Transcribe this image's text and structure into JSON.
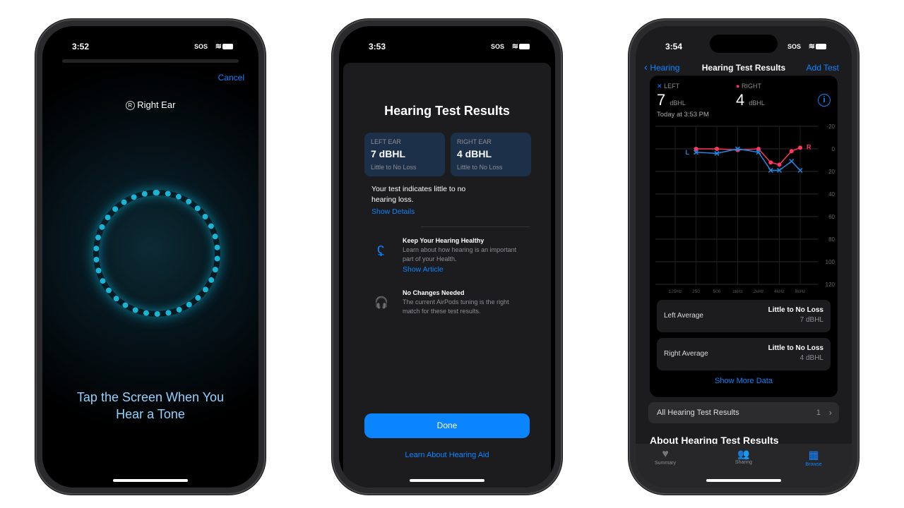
{
  "phone1": {
    "time": "3:52",
    "sos": "SOS",
    "cancel": "Cancel",
    "ear_label": "Right Ear",
    "ear_badge": "R",
    "instruction": "Tap the Screen When You Hear a Tone"
  },
  "phone2": {
    "time": "3:53",
    "sos": "SOS",
    "title": "Hearing Test Results",
    "left": {
      "label": "LEFT EAR",
      "value": "7 dBHL",
      "desc": "Little to No Loss"
    },
    "right": {
      "label": "RIGHT EAR",
      "value": "4 dBHL",
      "desc": "Little to No Loss"
    },
    "summary": "Your test indicates little to no hearing loss.",
    "show_details": "Show Details",
    "tips": [
      {
        "icon": "ear-check-icon",
        "title": "Keep Your Hearing Healthy",
        "body": "Learn about how hearing is an important part of your Health.",
        "link": "Show Article"
      },
      {
        "icon": "airpods-icon",
        "title": "No Changes Needed",
        "body": "The current AirPods tuning is the right match for these test results."
      }
    ],
    "done": "Done",
    "learn": "Learn About Hearing Aid"
  },
  "phone3": {
    "time": "3:54",
    "sos": "SOS",
    "back": "Hearing",
    "title": "Hearing Test Results",
    "add": "Add Test",
    "left_legend": "LEFT",
    "right_legend": "RIGHT",
    "left_value": "7",
    "right_value": "4",
    "unit": "dBHL",
    "date": "Today at 3:53 PM",
    "averages": [
      {
        "label": "Left Average",
        "status": "Little to No Loss",
        "value": "7 dBHL"
      },
      {
        "label": "Right Average",
        "status": "Little to No Loss",
        "value": "4 dBHL"
      }
    ],
    "show_more": "Show More Data",
    "all_results": "All Hearing Test Results",
    "all_count": "1",
    "about": "About Hearing Test Results",
    "tabs": [
      {
        "label": "Summary",
        "icon": "heart-icon"
      },
      {
        "label": "Sharing",
        "icon": "people-icon"
      },
      {
        "label": "Browse",
        "icon": "grid-icon",
        "active": true
      }
    ]
  },
  "chart_data": {
    "type": "line",
    "x_tick_labels": [
      "125Hz",
      "250",
      "500",
      "1kHz",
      "2kHz",
      "4kHz",
      "8kHz"
    ],
    "x_scale": "log",
    "ylim": [
      -20,
      120
    ],
    "y_inverted": true,
    "y_ticks": [
      "-20",
      "0",
      "20",
      "40",
      "60",
      "80",
      "100",
      "120"
    ],
    "grid": true,
    "x": [
      250,
      500,
      1000,
      2000,
      3000,
      4000,
      6000,
      8000
    ],
    "series": [
      {
        "name": "L",
        "marker": "x",
        "color": "#1e88e5",
        "values": [
          3,
          4,
          0,
          3,
          19,
          19,
          11,
          19
        ]
      },
      {
        "name": "R",
        "marker": "circle",
        "color": "#ff375f",
        "values": [
          0,
          0,
          1,
          0,
          12,
          14,
          2,
          -1
        ]
      }
    ]
  }
}
